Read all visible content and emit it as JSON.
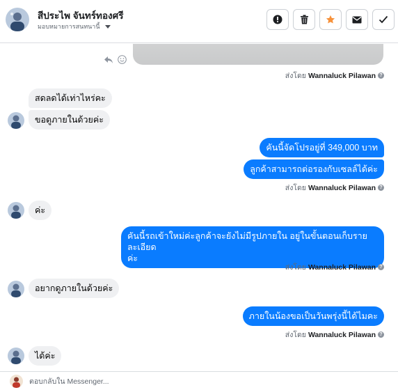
{
  "header": {
    "contact_name": "สีประไพ จันทร์ทองศรี",
    "assign_label": "มอบหมายการสนทนานี้",
    "actions": [
      {
        "name": "mark-spam-button",
        "icon": "exclamation-icon"
      },
      {
        "name": "delete-button",
        "icon": "trash-icon"
      },
      {
        "name": "star-button",
        "icon": "star-icon",
        "color": "#f7923b"
      },
      {
        "name": "mark-unread-button",
        "icon": "envelope-icon"
      },
      {
        "name": "mark-done-button",
        "icon": "check-icon"
      }
    ]
  },
  "sent_by": {
    "prefix": "ส่งโดย",
    "sender": "Wannaluck Pilawan"
  },
  "messages": [
    {
      "direction": "in",
      "text": "สดลดได้เท่าไหร่คะ"
    },
    {
      "direction": "in",
      "text": "ขอดูภายในด้วยค่ะ"
    },
    {
      "direction": "out",
      "text": "คันนี้จัดโปรอยู่ที่ 349,000 บาท"
    },
    {
      "direction": "out",
      "text": "ลูกค้าสามารถต่อรองกับเซลล์ได้ค่ะ"
    },
    {
      "direction": "in",
      "text": "ค่ะ"
    },
    {
      "direction": "out",
      "text": "คันนี้รถเข้าใหม่ค่ะลูกค้าจะยังไม่มีรูปภายใน  อยู่ในขั้นตอนเก็บรายละเอียด"
    },
    {
      "direction": "out",
      "text": "ค่ะ"
    },
    {
      "direction": "in",
      "text": "อยากดูภายในด้วยค่ะ"
    },
    {
      "direction": "out",
      "text": "ภายในน้องขอเป็นวันพรุ่งนี้ได้ไมคะ"
    },
    {
      "direction": "in",
      "text": "ได้ค่ะ"
    }
  ],
  "composer": {
    "placeholder": "ตอบกลับใน Messenger..."
  },
  "colors": {
    "outgoing_bubble": "#0a7cff",
    "incoming_bubble": "#eff0f2",
    "star": "#f7923b"
  }
}
